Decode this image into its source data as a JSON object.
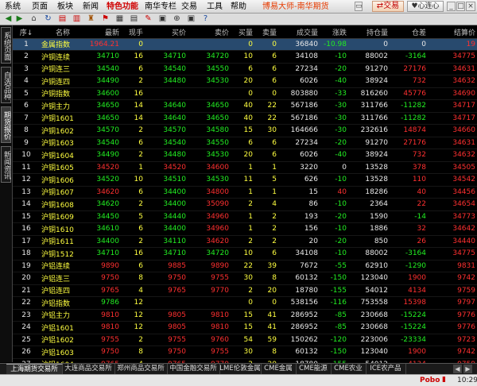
{
  "menu": [
    "系统",
    "页面",
    "板块",
    "新闻",
    "特色功能",
    "南华专栏",
    "交易",
    "工具",
    "帮助"
  ],
  "active_menu_index": 4,
  "app_title": "博易大师-南华期货",
  "trade_button": "交易",
  "service_button": "心连心",
  "toolbar_icons": [
    "back-icon",
    "forward-icon",
    "home-icon",
    "refresh-icon",
    "report-icon",
    "chart-icon",
    "cup-icon",
    "flag-icon",
    "grid-icon",
    "table-icon",
    "news-icon",
    "box-icon",
    "plus-icon",
    "box2-icon",
    "help-icon"
  ],
  "sidebar_tabs": [
    "系统页面",
    "自选品种",
    "期货报价",
    "新闻资讯"
  ],
  "sidebar_selected": 2,
  "columns": [
    "序↓",
    "名称",
    "最新",
    "现手",
    "买价",
    "卖价",
    "买量",
    "卖量",
    "成交量",
    "涨跌",
    "持仓量",
    "仓差",
    "结算价"
  ],
  "rows": [
    [
      "1",
      "金属指数",
      "1964.21",
      "0",
      "",
      "",
      "0",
      "0",
      "36840",
      "-10.98",
      "0",
      "0",
      "19"
    ],
    [
      "2",
      "沪铜连续",
      "34710",
      "16",
      "34710",
      "34720",
      "10",
      "6",
      "34108",
      "-10",
      "88002",
      "-3164",
      "34775"
    ],
    [
      "3",
      "沪铜连三",
      "34540",
      "6",
      "34540",
      "34550",
      "6",
      "6",
      "27234",
      "-20",
      "91270",
      "27176",
      "34631"
    ],
    [
      "4",
      "沪铜连四",
      "34490",
      "2",
      "34480",
      "34530",
      "20",
      "6",
      "6026",
      "-40",
      "38924",
      "732",
      "34632"
    ],
    [
      "5",
      "沪铜指数",
      "34600",
      "16",
      "",
      "",
      "0",
      "0",
      "803880",
      "-33",
      "816260",
      "45776",
      "34690"
    ],
    [
      "6",
      "沪铜主力",
      "34650",
      "14",
      "34640",
      "34650",
      "40",
      "22",
      "567186",
      "-30",
      "311766",
      "-11282",
      "34717"
    ],
    [
      "7",
      "沪铜1601",
      "34650",
      "14",
      "34640",
      "34650",
      "40",
      "22",
      "567186",
      "-30",
      "311766",
      "-11282",
      "34717"
    ],
    [
      "8",
      "沪铜1602",
      "34570",
      "2",
      "34570",
      "34580",
      "15",
      "30",
      "164666",
      "-30",
      "232616",
      "14874",
      "34660"
    ],
    [
      "9",
      "沪铜1603",
      "34540",
      "6",
      "34540",
      "34550",
      "6",
      "6",
      "27234",
      "-20",
      "91270",
      "27176",
      "34631"
    ],
    [
      "10",
      "沪铜1604",
      "34490",
      "2",
      "34480",
      "34530",
      "20",
      "6",
      "6026",
      "-40",
      "38924",
      "732",
      "34632"
    ],
    [
      "11",
      "沪铜1605",
      "34520",
      "1",
      "34520",
      "34600",
      "1",
      "1",
      "3220",
      "0",
      "13528",
      "378",
      "34505"
    ],
    [
      "12",
      "沪铜1606",
      "34520",
      "10",
      "34510",
      "34530",
      "11",
      "5",
      "626",
      "-10",
      "13528",
      "110",
      "34542"
    ],
    [
      "13",
      "沪铜1607",
      "34620",
      "6",
      "34400",
      "34800",
      "1",
      "1",
      "15",
      "40",
      "18286",
      "40",
      "34456"
    ],
    [
      "14",
      "沪铜1608",
      "34620",
      "2",
      "34400",
      "35090",
      "2",
      "4",
      "86",
      "-10",
      "2364",
      "22",
      "34654"
    ],
    [
      "15",
      "沪铜1609",
      "34450",
      "5",
      "34440",
      "34960",
      "1",
      "2",
      "193",
      "-20",
      "1590",
      "-14",
      "34773"
    ],
    [
      "16",
      "沪铜1610",
      "34610",
      "6",
      "34400",
      "34960",
      "1",
      "2",
      "156",
      "-10",
      "1886",
      "32",
      "34642"
    ],
    [
      "17",
      "沪铜1611",
      "34400",
      "2",
      "34110",
      "34620",
      "2",
      "2",
      "20",
      "-20",
      "850",
      "26",
      "34440"
    ],
    [
      "18",
      "沪铜1512",
      "34710",
      "16",
      "34710",
      "34720",
      "10",
      "6",
      "34108",
      "-10",
      "88002",
      "-3164",
      "34775"
    ],
    [
      "19",
      "沪铝连续",
      "9890",
      "6",
      "9885",
      "9890",
      "22",
      "39",
      "7672",
      "-55",
      "62910",
      "-1290",
      "9831"
    ],
    [
      "20",
      "沪铝连三",
      "9750",
      "8",
      "9750",
      "9755",
      "30",
      "8",
      "60132",
      "-150",
      "123040",
      "1900",
      "9742"
    ],
    [
      "21",
      "沪铝连四",
      "9765",
      "4",
      "9765",
      "9770",
      "2",
      "20",
      "18780",
      "-155",
      "54012",
      "4134",
      "9759"
    ],
    [
      "22",
      "沪铝指数",
      "9786",
      "12",
      "",
      "",
      "0",
      "0",
      "538156",
      "-116",
      "753558",
      "15398",
      "9797"
    ],
    [
      "23",
      "沪铝主力",
      "9810",
      "12",
      "9805",
      "9810",
      "15",
      "41",
      "286952",
      "-85",
      "230668",
      "-15224",
      "9776"
    ],
    [
      "24",
      "沪铝1601",
      "9810",
      "12",
      "9805",
      "9810",
      "15",
      "41",
      "286952",
      "-85",
      "230668",
      "-15224",
      "9776"
    ],
    [
      "25",
      "沪铝1602",
      "9755",
      "2",
      "9755",
      "9760",
      "54",
      "59",
      "150262",
      "-120",
      "223006",
      "-23334",
      "9723"
    ],
    [
      "26",
      "沪铝1603",
      "9750",
      "8",
      "9750",
      "9755",
      "30",
      "8",
      "60132",
      "-150",
      "123040",
      "1900",
      "9742"
    ],
    [
      "27",
      "沪铝1604",
      "9765",
      "4",
      "9765",
      "9770",
      "2",
      "20",
      "18780",
      "-155",
      "54012",
      "4134",
      "9759"
    ],
    [
      "28",
      "沪铝1605",
      "9780",
      "8",
      "9775",
      "9790",
      "5",
      "1",
      "9484",
      "-165",
      "23968",
      "180",
      "9801"
    ]
  ],
  "highlighted_row": 0,
  "bottom_tabs": [
    "上海期货交易所",
    "大连商品交易所",
    "郑州商品交易所",
    "中国金融交易所",
    "LME伦敦金属",
    "CME金属",
    "CME能源",
    "CME农业",
    "ICE农产品"
  ],
  "bottom_selected": 0,
  "status_brand": "Pobo",
  "status_time": "10:29"
}
